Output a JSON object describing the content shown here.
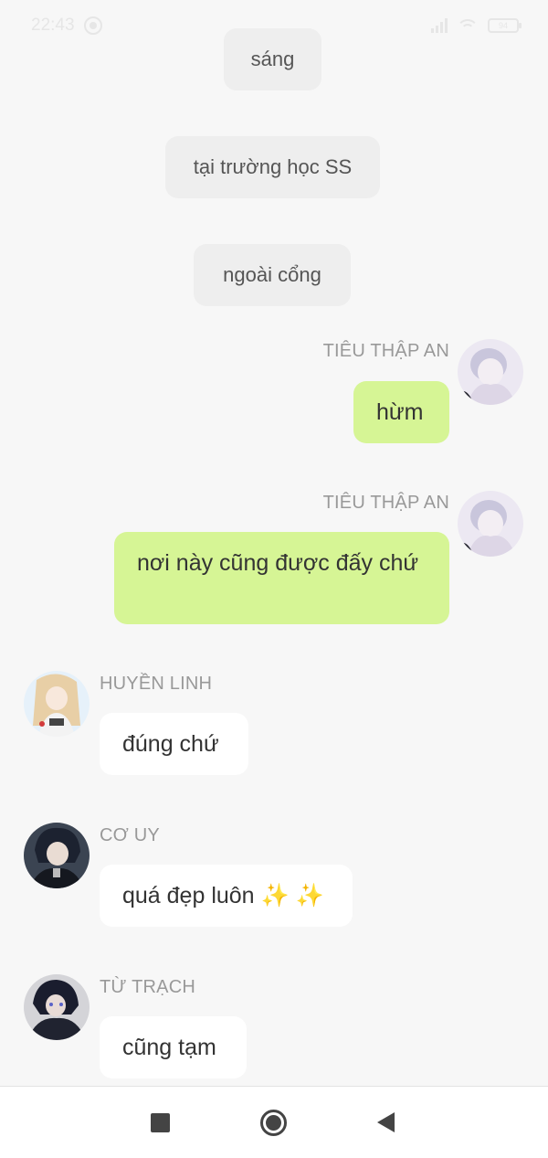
{
  "status_bar": {
    "time": "22:43",
    "battery": "94"
  },
  "system_messages": [
    {
      "text": "sáng"
    },
    {
      "text": "tại trường học SS"
    },
    {
      "text": "ngoài cổng"
    }
  ],
  "messages": [
    {
      "sender": "TIÊU THẬP AN",
      "text": "hừm",
      "side": "right",
      "bubble_color": "#d6f595"
    },
    {
      "sender": "TIÊU THẬP AN",
      "text": "nơi này cũng được đấy chứ",
      "side": "right",
      "bubble_color": "#d6f595"
    },
    {
      "sender": "HUYỀN LINH",
      "text": "đúng chứ",
      "side": "left",
      "bubble_color": "#ffffff"
    },
    {
      "sender": "CƠ UY",
      "text": "quá đẹp luôn ✨ ✨",
      "side": "left",
      "bubble_color": "#ffffff"
    },
    {
      "sender": "TỪ TRẠCH",
      "text": "cũng tạm",
      "side": "left",
      "bubble_color": "#ffffff"
    }
  ],
  "nav": {
    "recent_icon": "square-icon",
    "home_icon": "home-circle-icon",
    "back_icon": "back-triangle-icon"
  },
  "colors": {
    "background": "#f7f7f7",
    "sent_bubble": "#d6f595",
    "received_bubble": "#ffffff",
    "system_bubble": "#eeeeee",
    "name_text": "#999999"
  }
}
